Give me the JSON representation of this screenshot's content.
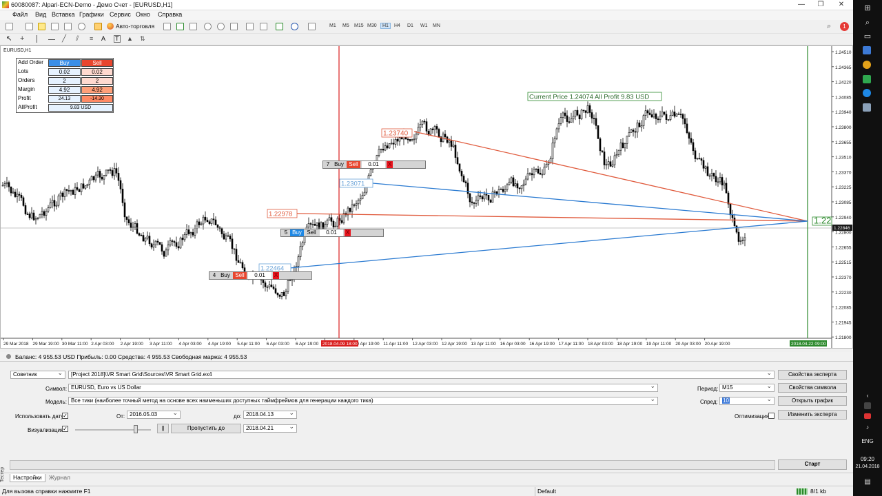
{
  "window": {
    "title": "60080087: Alpari-ECN-Demo - Демо Счет - [EURUSD,H1]",
    "minimize": "—",
    "restore": "❐",
    "close": "✕"
  },
  "menu": [
    "Файл",
    "Вид",
    "Вставка",
    "Графики",
    "Сервис",
    "Окно",
    "Справка"
  ],
  "toolbar": {
    "autotrade_label": "Авто-торговля",
    "timeframes": [
      "M1",
      "M5",
      "M15",
      "M30",
      "H1",
      "H4",
      "D1",
      "W1",
      "MN"
    ],
    "active_timeframe": "H1",
    "text_tool": "A",
    "label_tool": "T"
  },
  "chart": {
    "symbol_label": "EURUSD,H1",
    "current_price_label": "Current Price 1.24074 All Profit 9.83 USD",
    "line_level_label": "1.22978",
    "top_level_label": "1.23740",
    "mid_level_label": "1.23071",
    "low_level_label": "1.22464",
    "apex_label": "1.22",
    "price_badge": "1.22846",
    "price_axis": [
      "1.24510",
      "1.24365",
      "1.24220",
      "1.24085",
      "1.23940",
      "1.23800",
      "1.23655",
      "1.23510",
      "1.23370",
      "1.23225",
      "1.23085",
      "1.22940",
      "1.22800",
      "1.22655",
      "1.22515",
      "1.22370",
      "1.22230",
      "1.22085",
      "1.21945",
      "1.21800"
    ],
    "time_axis": [
      "29 Mar 2018",
      "29 Mar 19:00",
      "30 Mar 11:00",
      "2 Apr 03:00",
      "2 Apr 19:00",
      "3 Apr 11:00",
      "4 Apr 03:00",
      "4 Apr 19:00",
      "5 Apr 11:00",
      "6 Apr 03:00",
      "6 Apr 19:00",
      "9 Apr 03:00",
      "10 Apr 19:00",
      "11 Apr 11:00",
      "12 Apr 03:00",
      "12 Apr 19:00",
      "13 Apr 11:00",
      "16 Apr 03:00",
      "16 Apr 19:00",
      "17 Apr 11:00",
      "18 Apr 03:00",
      "18 Apr 19:00",
      "19 Apr 11:00",
      "20 Apr 03:00",
      "20 Apr 19:00"
    ],
    "red_time_marker": "2018.04.09 18:00",
    "green_time_marker": "2018.04.22 09:00",
    "colors": {
      "sell": "#e8462e",
      "buy": "#1e88e5",
      "red_line": "#e05a3c",
      "blue_line": "#2a7ad1",
      "green_line": "#2d8a2d",
      "vline_red": "#d91e1e"
    }
  },
  "order_panel": {
    "header": {
      "label": "Add Order",
      "buy": "Buy",
      "sell": "Sell"
    },
    "rows": [
      {
        "label": "Lots",
        "buy": "0.02",
        "sell": "0.02"
      },
      {
        "label": "Orders",
        "buy": "2",
        "sell": "2"
      },
      {
        "label": "Margin",
        "buy": "4.92",
        "sell": "4.92"
      },
      {
        "label": "Profit",
        "buy": "24.13",
        "sell": "-14.30"
      }
    ],
    "allprofit_label": "AllProfit",
    "allprofit_value": "9.83 USD"
  },
  "grid_widgets": [
    {
      "num": "7",
      "buy": "Buy",
      "sell": "Sell",
      "lot": "0.01",
      "close": "X"
    },
    {
      "num": "5",
      "buy": "Buy",
      "sell": "Sell",
      "lot": "0.01",
      "close": "X"
    },
    {
      "num": "4",
      "buy": "Buy",
      "sell": "Sell",
      "lot": "0.01",
      "close": "X"
    }
  ],
  "balance": {
    "text": "Баланс: 4 955.53 USD  Прибыль: 0.00  Средства: 4 955.53  Свободная маржа: 4 955.53"
  },
  "tester": {
    "type_value": "Советник",
    "expert_path": "[Project 2018]\\VR Smart Grid\\Sources\\VR Smart Grid.ex4",
    "expert_props_button": "Свойства эксперта",
    "symbol_label": "Символ:",
    "symbol_value": "EURUSD, Euro vs US Dollar",
    "symbol_props_button": "Свойства символа",
    "period_label": "Период:",
    "period_value": "M15",
    "model_label": "Модель:",
    "model_value": "Все тики (наиболее точный метод на основе всех наименьших доступных таймфреймов для генерации каждого тика)",
    "spread_label": "Спред:",
    "spread_value": "10",
    "open_chart_button": "Открыть график",
    "use_date_label": "Использовать дату",
    "from_label": "От:",
    "from_value": "2016.05.03",
    "to_label": "до:",
    "to_value": "2018.04.13",
    "optimization_label": "Оптимизация",
    "modify_expert_button": "Изменить эксперта",
    "visualization_label": "Визуализация",
    "pause_button": "||",
    "skip_to_button": "Пропустить до",
    "skip_to_value": "2018.04.21",
    "start_button": "Старт",
    "check_mark": "✓"
  },
  "tabs": {
    "settings": "Настройки",
    "journal": "Журнал",
    "tester_vertical": "Тестер"
  },
  "statusbar": {
    "help": "Для вызова справки нажмите F1",
    "profile": "Default",
    "traffic": "8/1 kb"
  },
  "taskbar": {
    "lang": "ENG",
    "time": "09:20",
    "date": "21.04.2018",
    "notif_badge": "1"
  }
}
